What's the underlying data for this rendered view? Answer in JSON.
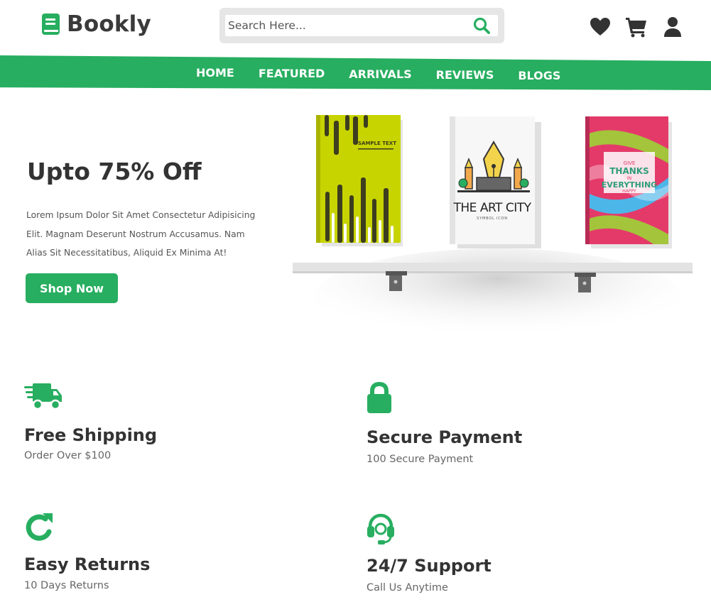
{
  "brand": {
    "name": "Bookly",
    "logo_icon": "book-icon"
  },
  "search": {
    "placeholder": "Search Here...",
    "value": "",
    "icon": "search-icon"
  },
  "header_icons": [
    "heart-icon",
    "cart-icon",
    "user-icon"
  ],
  "nav": {
    "items": [
      {
        "label": "HOME"
      },
      {
        "label": "FEATURED"
      },
      {
        "label": "ARRIVALS"
      },
      {
        "label": "REVIEWS"
      },
      {
        "label": "BLOGS"
      }
    ]
  },
  "hero": {
    "title": "Upto 75% Off",
    "description": "Lorem Ipsum Dolor Sit Amet Consectetur Adipisicing Elit. Magnam Deserunt Nostrum Accusamus. Nam Alias Sit Necessitatibus, Aliquid Ex Minima At!",
    "button_label": "Shop Now"
  },
  "books": {
    "book1_text": "SAMPLE TEXT",
    "book2_title": "THE ART CITY",
    "book2_subtitle": "SYMBOL ICON",
    "book3_lines": [
      "GIVE",
      "THANKS",
      "IN",
      "EVERYTHING",
      "HAPPY"
    ]
  },
  "features": [
    {
      "icon": "truck-icon",
      "title": "Free Shipping",
      "subtitle": "Order Over $100"
    },
    {
      "icon": "lock-icon",
      "title": "Secure Payment",
      "subtitle": "100 Secure Payment"
    },
    {
      "icon": "redo-icon",
      "title": "Easy Returns",
      "subtitle": "10 Days Returns"
    },
    {
      "icon": "headset-icon",
      "title": "24/7 Support",
      "subtitle": "Call Us Anytime"
    }
  ],
  "colors": {
    "accent": "#27ae60",
    "text_dark": "#333333",
    "text_muted": "#666666",
    "search_bg": "#e6e6e6"
  }
}
